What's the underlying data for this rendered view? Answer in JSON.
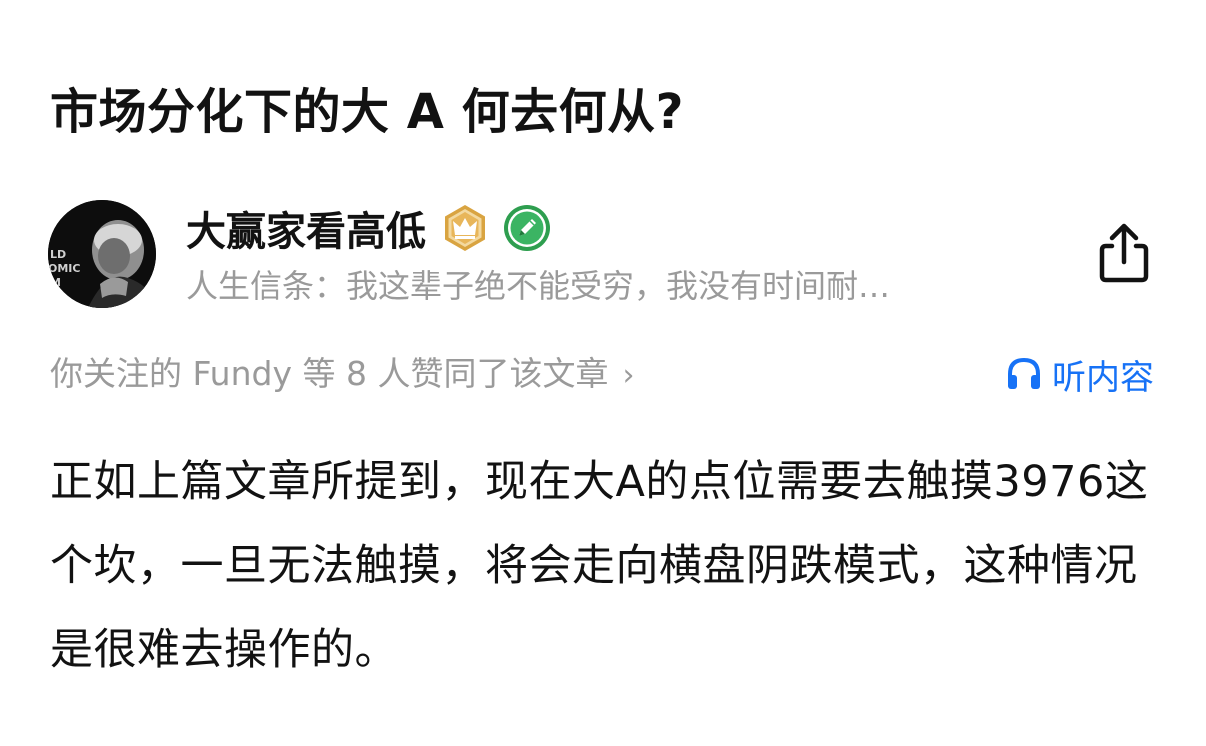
{
  "article": {
    "title": "市场分化下的大 A 何去何从?",
    "body": "正如上篇文章所提到，现在大A的点位需要去触摸3976这个坎，一旦无法触摸，将会走向横盘阴跌模式，这种情况是很难去操作的。"
  },
  "author": {
    "name": "大赢家看高低",
    "bio": "人生信条：我这辈子绝不能受穷，我没有时间耐…",
    "avatar_text": [
      "LD",
      "OMIC",
      "M"
    ],
    "badges": [
      "crown-badge-icon",
      "pencil-badge-icon"
    ]
  },
  "social": {
    "likes_text": "你关注的 Fundy 等 8 人赞同了该文章",
    "likes_chevron": "›"
  },
  "actions": {
    "listen_label": "听内容",
    "share_icon": "share-icon",
    "headphones_icon": "headphones-icon"
  },
  "colors": {
    "accent": "#1772f6",
    "muted_text": "#9a9a9a",
    "primary_text": "#121212",
    "crown_badge": "#d9a441",
    "pencil_badge": "#2e9e4f"
  }
}
